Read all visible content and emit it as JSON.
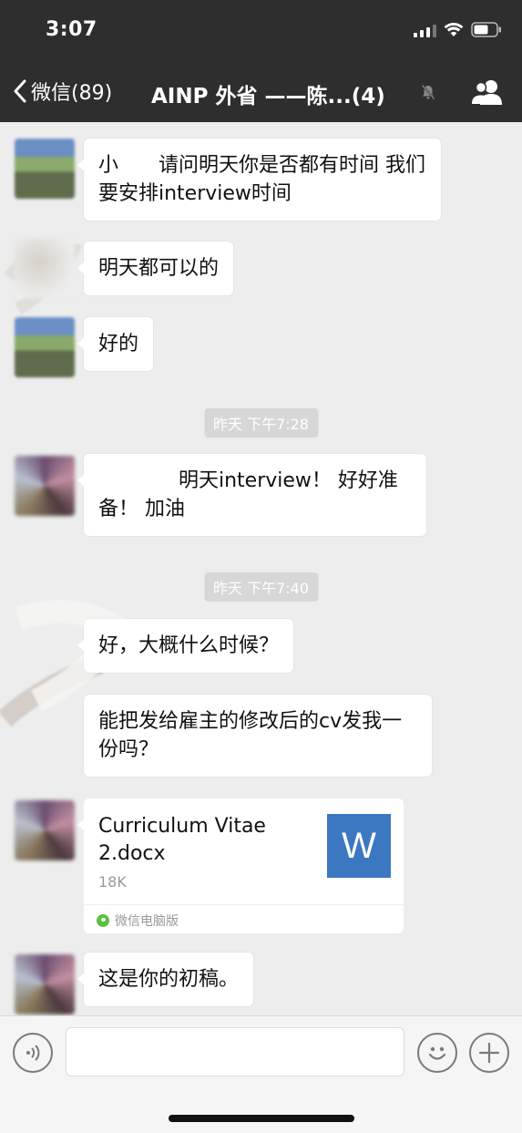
{
  "status_bar": {
    "time": "3:07"
  },
  "nav": {
    "back_label": "微信(89)",
    "title": "AINP 外省 ——陈...(4)"
  },
  "messages": [
    {
      "type": "text",
      "text": "小　　请问明天你是否都有时间 我们要安排interview时间"
    },
    {
      "type": "text",
      "text": "明天都可以的"
    },
    {
      "type": "text",
      "text": "好的"
    },
    {
      "type": "time",
      "text": "昨天 下午7:28"
    },
    {
      "type": "text",
      "text": "　　　　明天interview！ 好好准备！ 加油"
    },
    {
      "type": "time",
      "text": "昨天 下午7:40"
    },
    {
      "type": "text",
      "text": "好，大概什么时候？"
    },
    {
      "type": "text",
      "text": "能把发给雇主的修改后的cv发我一份吗？"
    },
    {
      "type": "file",
      "file_name": "Curriculum Vitae 2.docx",
      "file_size": "18K",
      "file_letter": "W",
      "source": "微信电脑版"
    },
    {
      "type": "text",
      "text": "这是你的初稿。"
    }
  ],
  "icons": {
    "back": "chevron-left-icon",
    "mute": "mute-bell-icon",
    "group": "group-people-icon",
    "voice": "voice-icon",
    "emoji": "emoji-icon",
    "plus": "plus-icon"
  },
  "colors": {
    "header_bg": "#2e2e2e",
    "chat_bg": "#ededed",
    "bubble_bg": "#ffffff",
    "word_icon_bg": "#3c77c2"
  }
}
